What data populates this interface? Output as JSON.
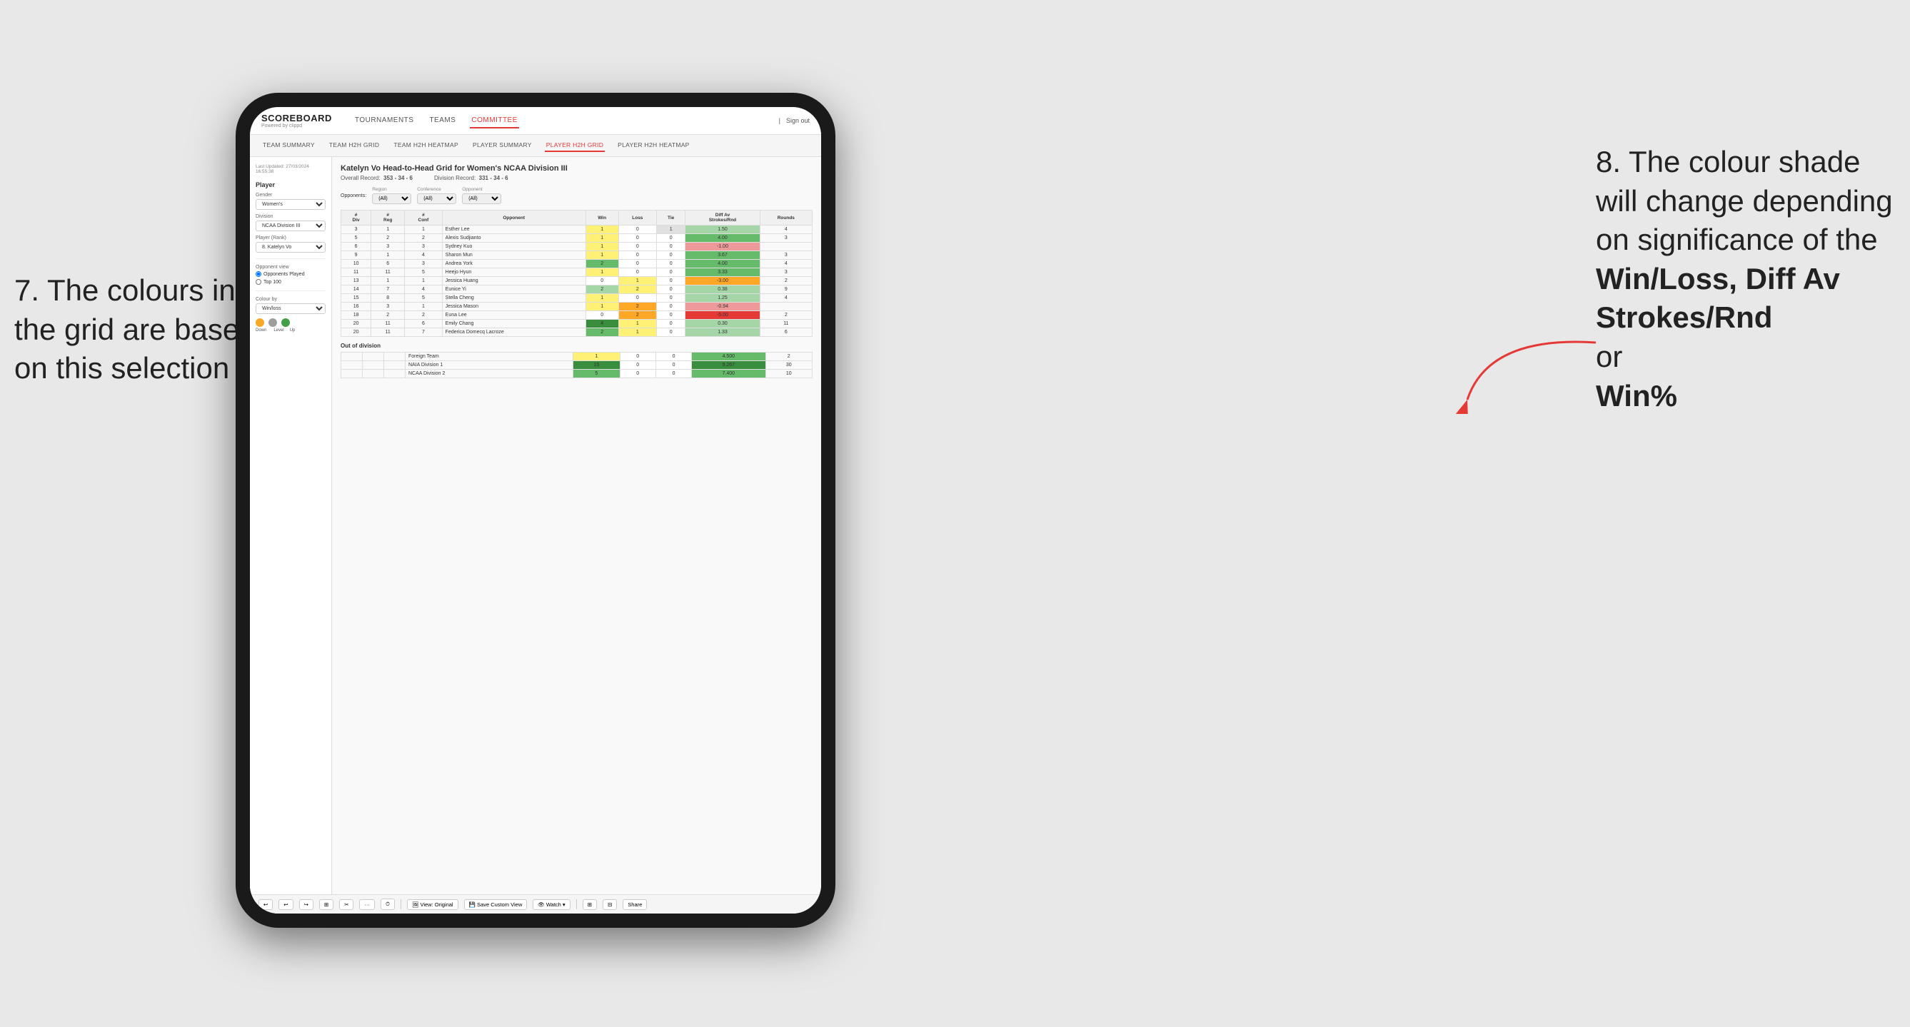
{
  "annotations": {
    "left_title": "7. The colours in the grid are based on this selection",
    "right_title": "8. The colour shade will change depending on significance of the",
    "right_bold1": "Win/Loss,",
    "right_bold2": "Diff Av Strokes/Rnd",
    "right_or": "or",
    "right_bold3": "Win%"
  },
  "nav": {
    "logo": "SCOREBOARD",
    "logo_sub": "Powered by clippd",
    "items": [
      "TOURNAMENTS",
      "TEAMS",
      "COMMITTEE"
    ],
    "active": "COMMITTEE",
    "right_items": [
      "Sign out"
    ]
  },
  "sub_nav": {
    "items": [
      "TEAM SUMMARY",
      "TEAM H2H GRID",
      "TEAM H2H HEATMAP",
      "PLAYER SUMMARY",
      "PLAYER H2H GRID",
      "PLAYER H2H HEATMAP"
    ],
    "active": "PLAYER H2H GRID"
  },
  "sidebar": {
    "timestamp": "Last Updated: 27/03/2024 16:55:38",
    "player_section": "Player",
    "gender_label": "Gender",
    "gender_value": "Women's",
    "division_label": "Division",
    "division_value": "NCAA Division III",
    "player_rank_label": "Player (Rank)",
    "player_rank_value": "8. Katelyn Vo",
    "opponent_view_label": "Opponent view",
    "opponent_view_options": [
      "Opponents Played",
      "Top 100"
    ],
    "opponent_view_selected": "Opponents Played",
    "colour_by_label": "Colour by",
    "colour_by_value": "Win/loss",
    "legend_down": "Down",
    "legend_level": "Level",
    "legend_up": "Up"
  },
  "content": {
    "title": "Katelyn Vo Head-to-Head Grid for Women's NCAA Division III",
    "overall_record_label": "Overall Record:",
    "overall_record_value": "353 - 34 - 6",
    "division_record_label": "Division Record:",
    "division_record_value": "331 - 34 - 6",
    "filters": {
      "region_label": "Region",
      "region_value": "(All)",
      "conference_label": "Conference",
      "conference_value": "(All)",
      "opponent_label": "Opponent",
      "opponent_value": "(All)",
      "opponents_label": "Opponents:"
    },
    "table_headers": [
      "#\nDiv",
      "#\nReg",
      "#\nConf",
      "Opponent",
      "Win",
      "Loss",
      "Tie",
      "Diff Av\nStrokes/Rnd",
      "Rounds"
    ],
    "rows": [
      {
        "div": "3",
        "reg": "1",
        "conf": "1",
        "opponent": "Esther Lee",
        "win": "1",
        "loss": "0",
        "tie": "1",
        "diff": "1.50",
        "rounds": "4",
        "win_color": "yellow",
        "loss_color": "white",
        "tie_color": "gray",
        "diff_color": "light-green"
      },
      {
        "div": "5",
        "reg": "2",
        "conf": "2",
        "opponent": "Alexis Sudjianto",
        "win": "1",
        "loss": "0",
        "tie": "0",
        "diff": "4.00",
        "rounds": "3",
        "win_color": "yellow",
        "loss_color": "white",
        "tie_color": "white",
        "diff_color": "green"
      },
      {
        "div": "6",
        "reg": "3",
        "conf": "3",
        "opponent": "Sydney Kuo",
        "win": "1",
        "loss": "0",
        "tie": "0",
        "diff": "-1.00",
        "rounds": "",
        "win_color": "yellow",
        "loss_color": "white",
        "tie_color": "white",
        "diff_color": "red-light"
      },
      {
        "div": "9",
        "reg": "1",
        "conf": "4",
        "opponent": "Sharon Mun",
        "win": "1",
        "loss": "0",
        "tie": "0",
        "diff": "3.67",
        "rounds": "3",
        "win_color": "yellow",
        "loss_color": "white",
        "tie_color": "white",
        "diff_color": "green"
      },
      {
        "div": "10",
        "reg": "6",
        "conf": "3",
        "opponent": "Andrea York",
        "win": "2",
        "loss": "0",
        "tie": "0",
        "diff": "4.00",
        "rounds": "4",
        "win_color": "green-med",
        "loss_color": "white",
        "tie_color": "white",
        "diff_color": "green"
      },
      {
        "div": "11",
        "reg": "11",
        "conf": "5",
        "opponent": "Heejo Hyun",
        "win": "1",
        "loss": "0",
        "tie": "0",
        "diff": "3.33",
        "rounds": "3",
        "win_color": "yellow",
        "loss_color": "white",
        "tie_color": "white",
        "diff_color": "green"
      },
      {
        "div": "13",
        "reg": "1",
        "conf": "1",
        "opponent": "Jessica Huang",
        "win": "0",
        "loss": "1",
        "tie": "0",
        "diff": "-3.00",
        "rounds": "2",
        "win_color": "white",
        "loss_color": "yellow",
        "tie_color": "white",
        "diff_color": "orange"
      },
      {
        "div": "14",
        "reg": "7",
        "conf": "4",
        "opponent": "Eunice Yi",
        "win": "2",
        "loss": "2",
        "tie": "0",
        "diff": "0.38",
        "rounds": "9",
        "win_color": "green-light",
        "loss_color": "yellow-loss",
        "tie_color": "white",
        "diff_color": "light-green"
      },
      {
        "div": "15",
        "reg": "8",
        "conf": "5",
        "opponent": "Stella Cheng",
        "win": "1",
        "loss": "0",
        "tie": "0",
        "diff": "1.25",
        "rounds": "4",
        "win_color": "yellow",
        "loss_color": "white",
        "tie_color": "white",
        "diff_color": "light-green"
      },
      {
        "div": "16",
        "reg": "3",
        "conf": "1",
        "opponent": "Jessica Mason",
        "win": "1",
        "loss": "2",
        "tie": "0",
        "diff": "-0.94",
        "rounds": "",
        "win_color": "yellow",
        "loss_color": "orange-loss",
        "tie_color": "white",
        "diff_color": "red-light"
      },
      {
        "div": "18",
        "reg": "2",
        "conf": "2",
        "opponent": "Euna Lee",
        "win": "0",
        "loss": "2",
        "tie": "0",
        "diff": "-5.00",
        "rounds": "2",
        "win_color": "white",
        "loss_color": "orange-loss",
        "tie_color": "white",
        "diff_color": "red-dark"
      },
      {
        "div": "20",
        "reg": "11",
        "conf": "6",
        "opponent": "Emily Chang",
        "win": "4",
        "loss": "1",
        "tie": "0",
        "diff": "0.30",
        "rounds": "11",
        "win_color": "green-dark",
        "loss_color": "yellow-loss",
        "tie_color": "white",
        "diff_color": "light-green"
      },
      {
        "div": "20",
        "reg": "11",
        "conf": "7",
        "opponent": "Federica Domecq Lacroze",
        "win": "2",
        "loss": "1",
        "tie": "0",
        "diff": "1.33",
        "rounds": "6",
        "win_color": "green-med",
        "loss_color": "yellow-loss",
        "tie_color": "white",
        "diff_color": "light-green"
      }
    ],
    "out_of_division_label": "Out of division",
    "out_of_division_rows": [
      {
        "opponent": "Foreign Team",
        "win": "1",
        "loss": "0",
        "tie": "0",
        "diff": "4.500",
        "rounds": "2",
        "win_color": "yellow",
        "diff_color": "green"
      },
      {
        "opponent": "NAIA Division 1",
        "win": "15",
        "loss": "0",
        "tie": "0",
        "diff": "9.267",
        "rounds": "30",
        "win_color": "green-dark",
        "diff_color": "green-dark"
      },
      {
        "opponent": "NCAA Division 2",
        "win": "5",
        "loss": "0",
        "tie": "0",
        "diff": "7.400",
        "rounds": "10",
        "win_color": "green-med",
        "diff_color": "green"
      }
    ]
  },
  "toolbar": {
    "buttons": [
      "↩",
      "↩",
      "↪",
      "⊞",
      "✂",
      "·",
      "⏱",
      "|",
      "View: Original",
      "Save Custom View",
      "Watch ▾",
      "⊞",
      "⊞",
      "Share"
    ]
  }
}
